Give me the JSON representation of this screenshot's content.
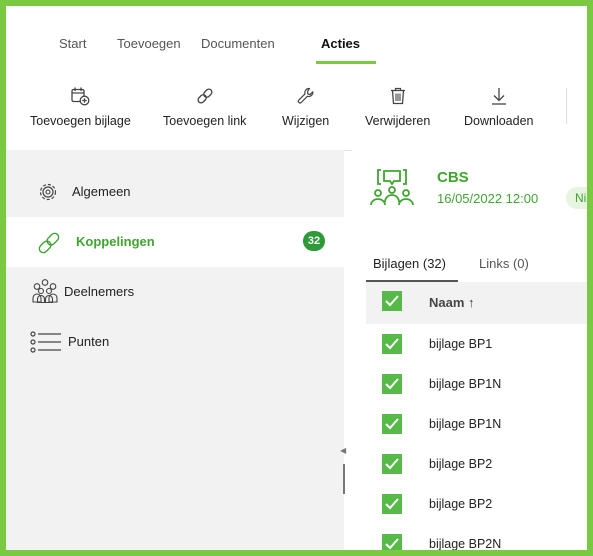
{
  "tabs": [
    {
      "label": "Start"
    },
    {
      "label": "Toevoegen"
    },
    {
      "label": "Documenten"
    },
    {
      "label": "Acties"
    }
  ],
  "ribbon": {
    "buttons": [
      {
        "label": "Toevoegen bijlage",
        "icon": "calendar-add-icon"
      },
      {
        "label": "Toevoegen link",
        "icon": "link-icon"
      },
      {
        "label": "Wijzigen",
        "icon": "wrench-icon"
      },
      {
        "label": "Verwijderen",
        "icon": "trash-icon"
      },
      {
        "label": "Downloaden",
        "icon": "download-icon"
      }
    ]
  },
  "sidebar": {
    "items": [
      {
        "label": "Algemeen",
        "icon": "gear-icon"
      },
      {
        "label": "Koppelingen",
        "icon": "link-icon",
        "badge": "32"
      },
      {
        "label": "Deelnemers",
        "icon": "people-icon"
      },
      {
        "label": "Punten",
        "icon": "list-icon"
      }
    ]
  },
  "header": {
    "title": "CBS",
    "datetime": "16/05/2022 12:00",
    "status": "Nieuw"
  },
  "subtabs": [
    {
      "label": "Bijlagen (32)"
    },
    {
      "label": "Links (0)"
    }
  ],
  "table": {
    "column_name": "Naam",
    "rows": [
      {
        "name": "bijlage BP1"
      },
      {
        "name": "bijlage BP1N"
      },
      {
        "name": "bijlage BP1N"
      },
      {
        "name": "bijlage BP2"
      },
      {
        "name": "bijlage BP2"
      },
      {
        "name": "bijlage BP2N"
      }
    ]
  },
  "colors": {
    "accent": "#7ac943",
    "text_green": "#3fa530",
    "checkbox": "#56b948",
    "badge": "#2e9a3a"
  }
}
